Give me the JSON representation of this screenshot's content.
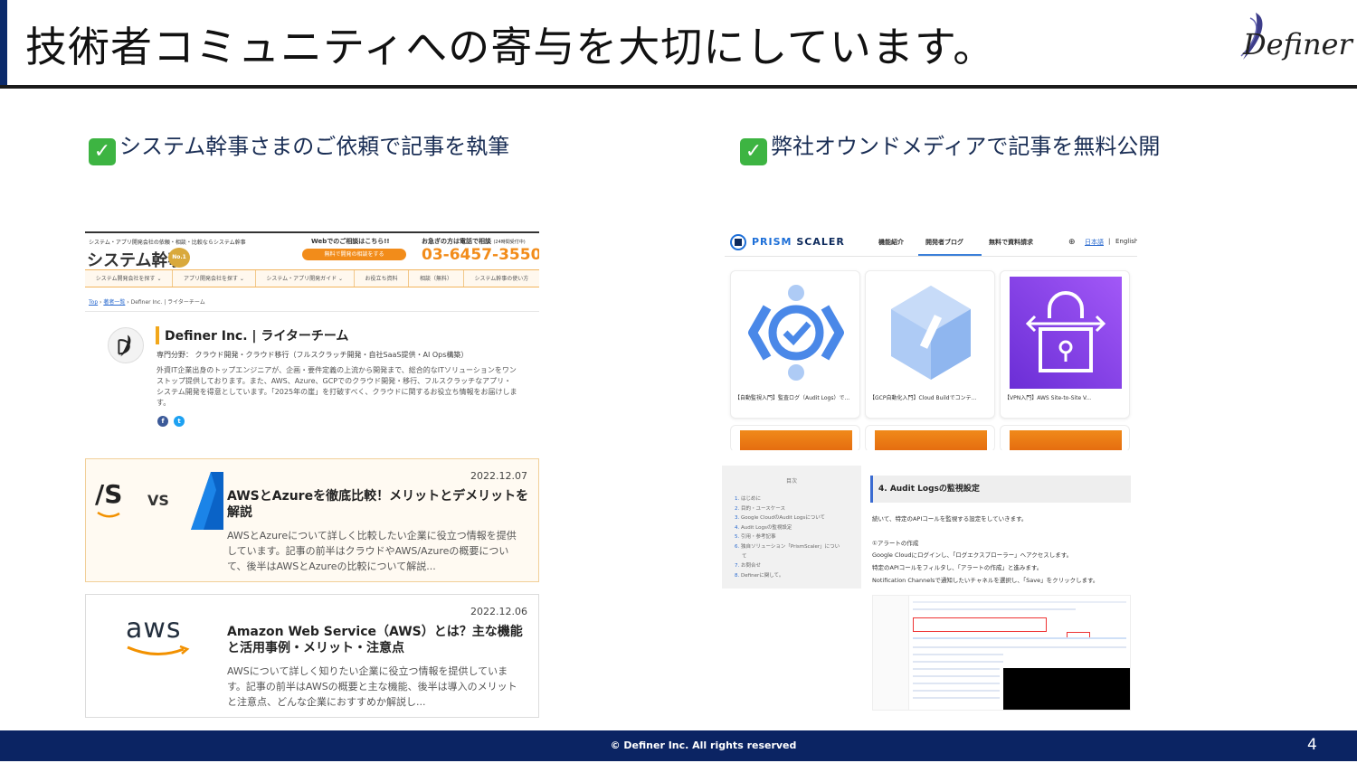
{
  "slide": {
    "title": "技術者コミュニティへの寄与を大切にしています。",
    "logo_text": "Definer",
    "footer": "© Definer Inc. All rights reserved",
    "page_number": "4"
  },
  "sections": {
    "left_heading": "システム幹事さまのご依頼で記事を執筆",
    "right_heading": "弊社オウンドメディアで記事を無料公開",
    "check_icon": "✅"
  },
  "left_site": {
    "tagline": "システム・アプリ開発会社の依頼・相談・比較ならシステム幹事",
    "brand": "システム幹事",
    "badge": "No.1",
    "web_consult": "Webでのご相談はこちら!!",
    "web_button": "無料で開発の相談をする",
    "phone_label": "お急ぎの方は電話で相談",
    "phone_note": "(24時間受付中)",
    "phone": "03-6457-3550",
    "nav": [
      "システム開発会社を探す ⌄",
      "アプリ開発会社を探す ⌄",
      "システム・アプリ開発ガイド ⌄",
      "お役立ち資料",
      "相談（無料）",
      "システム幹事の使い方"
    ],
    "breadcrumb": {
      "top": "Top",
      "list": "著者一覧",
      "current": "Definer Inc. | ライターチーム"
    },
    "author": {
      "name": "Definer Inc. | ライターチーム",
      "field": "専門分野： クラウド開発・クラウド移行（フルスクラッチ開発・自社SaaS提供・AI Ops構築）",
      "bio": "外資IT企業出身のトップエンジニアが、企画・要件定義の上流から開発まで、総合的なITソリューションをワンストップ提供しております。また、AWS、Azure、GCPでのクラウド開発・移行、フルスクラッチなアプリ・システム開発を得意としています。「2025年の崖」を打破すべく、クラウドに関するお役立ち情報をお届けします。",
      "social": [
        "f",
        "t"
      ]
    },
    "articles": [
      {
        "date": "2022.12.07",
        "thumb_left": "/S",
        "thumb_vs": "VS",
        "title": "AWSとAzureを徹底比較！メリットとデメリットを解説",
        "excerpt": "AWSとAzureについて詳しく比較したい企業に役立つ情報を提供しています。記事の前半はクラウドやAWS/Azureの概要について、後半はAWSとAzureの比較について解説..."
      },
      {
        "date": "2022.12.06",
        "thumb": "aws",
        "title": "Amazon Web Service（AWS）とは？主な機能と活用事例・メリット・注意点",
        "excerpt": "AWSについて詳しく知りたい企業に役立つ情報を提供しています。記事の前半はAWSの概要と主な機能、後半は導入のメリットと注意点、どんな企業におすすめか解説し..."
      }
    ]
  },
  "right_site": {
    "brand_a": "PRISM",
    "brand_b": "SCALER",
    "nav": [
      "機能紹介",
      "開発者ブログ",
      "無料で資料請求"
    ],
    "lang_jp": "日本語",
    "lang_sep": "|",
    "lang_en": "English",
    "cards": [
      {
        "title": "【自動監視入門】監査ログ（Audit Logs）で...",
        "icon": "audit-log-icon"
      },
      {
        "title": "【GCP自動化入門】Cloud Buildでコンテ...",
        "icon": "cloud-build-icon"
      },
      {
        "title": "【VPN入門】AWS Site-to-Site V...",
        "icon": "vpn-lock-icon"
      }
    ],
    "toc": {
      "heading": "目次",
      "items": [
        "はじめに",
        "目的・ユースケース",
        "Google CloudのAudit Logsについて",
        "Audit Logsの監視設定",
        "引用・参考記事",
        "独自ソリューション「PrismScaler」につい",
        "て",
        "お問合せ",
        "Definerに関して。"
      ],
      "numbers": [
        "1.",
        "2.",
        "3.",
        "4.",
        "5.",
        "6.",
        "",
        "7.",
        "8."
      ]
    },
    "article": {
      "heading": "4. Audit Logsの監視設定",
      "lines": [
        "続いて、特定のAPIコールを監視する設定をしていきます。",
        "①アラートの作成",
        "Google Cloudにログインし、「ログエクスプローラー」へアクセスします。",
        "特定のAPIコールをフィルタし、「アラートの作成」と進みます。",
        "Notification Channelsで通知したいチャネルを選択し、「Save」をクリックします。"
      ]
    }
  },
  "colors": {
    "navy": "#0b2463",
    "accent_orange": "#f28c1a",
    "check_green": "#3db442",
    "azure_blue": "#0a63c7",
    "vpn_purple": "#8b45f0"
  }
}
